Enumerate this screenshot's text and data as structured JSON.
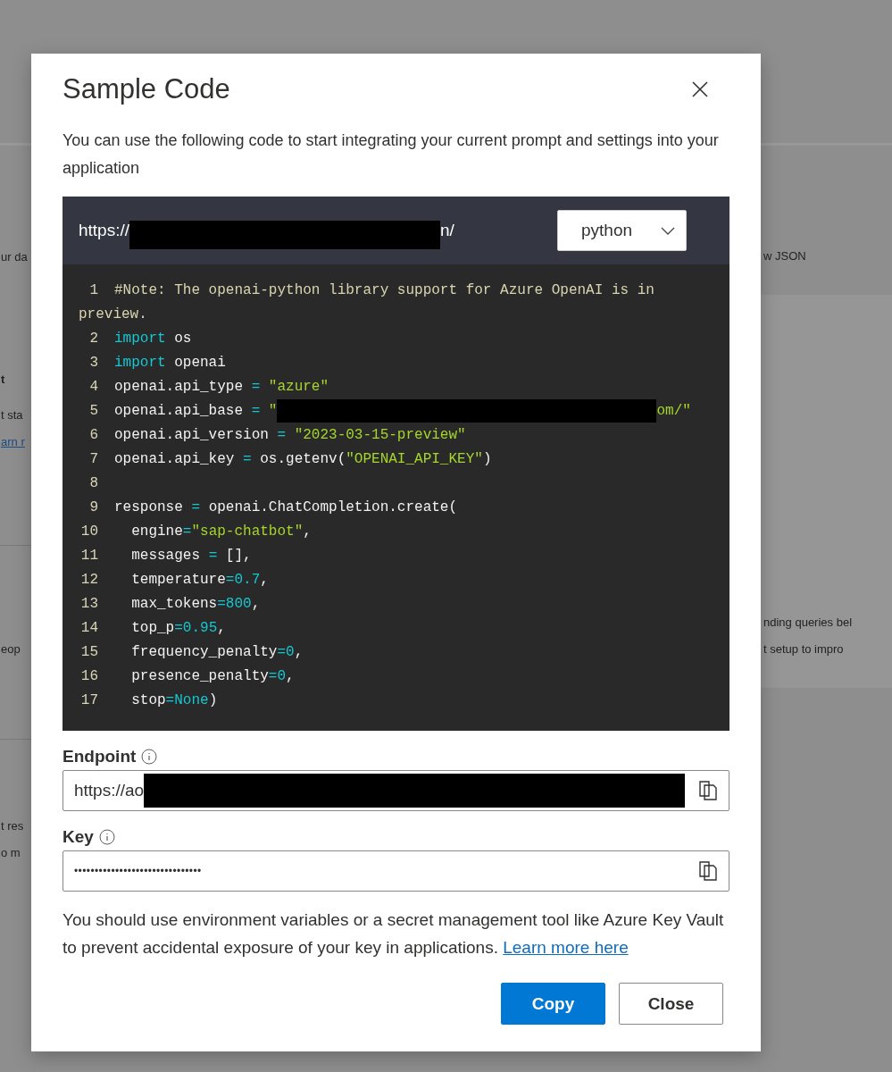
{
  "background": {
    "left": [
      {
        "text": "ur da",
        "kind": "plain"
      },
      {
        "text": "t",
        "kind": "bold"
      },
      {
        "text": "t sta",
        "kind": "plain"
      },
      {
        "text": "arn r",
        "kind": "link"
      },
      {
        "text": "eop",
        "kind": "plain"
      },
      {
        "text": "t res",
        "kind": "plain"
      },
      {
        "text": "o m",
        "kind": "plain"
      }
    ],
    "right": [
      {
        "text": "w JSON"
      },
      {
        "text": "nding queries bel"
      },
      {
        "text": "t setup to impro"
      }
    ]
  },
  "dialog": {
    "title": "Sample Code",
    "description": "You can use the following code to start integrating your current prompt and settings into your application",
    "code": {
      "url_start": "https://",
      "url_end": "n/",
      "language": "python",
      "lines": [
        {
          "number": "1",
          "tokens": [
            {
              "kind": "comment",
              "text": "#Note: The openai-python library support for Azure OpenAI is in preview."
            }
          ]
        },
        {
          "number": "2",
          "tokens": [
            {
              "kind": "keyword",
              "text": "import"
            },
            {
              "kind": "plain",
              "text": " os"
            }
          ]
        },
        {
          "number": "3",
          "tokens": [
            {
              "kind": "keyword",
              "text": "import"
            },
            {
              "kind": "plain",
              "text": " openai"
            }
          ]
        },
        {
          "number": "4",
          "tokens": [
            {
              "kind": "plain",
              "text": "openai.api_type "
            },
            {
              "kind": "op",
              "text": "= "
            },
            {
              "kind": "string",
              "text": "\"azure\""
            }
          ]
        },
        {
          "number": "5",
          "tokens": [
            {
              "kind": "plain",
              "text": "openai.api_base "
            },
            {
              "kind": "op",
              "text": "= "
            },
            {
              "kind": "string",
              "text": "\""
            },
            {
              "kind": "redaction"
            },
            {
              "kind": "string",
              "text": "om/\""
            }
          ]
        },
        {
          "number": "6",
          "tokens": [
            {
              "kind": "plain",
              "text": "openai.api_version "
            },
            {
              "kind": "op",
              "text": "= "
            },
            {
              "kind": "string",
              "text": "\"2023-03-15-preview\""
            }
          ]
        },
        {
          "number": "7",
          "tokens": [
            {
              "kind": "plain",
              "text": "openai.api_key "
            },
            {
              "kind": "op",
              "text": "= "
            },
            {
              "kind": "plain",
              "text": "os.getenv("
            },
            {
              "kind": "string",
              "text": "\"OPENAI_API_KEY\""
            },
            {
              "kind": "plain",
              "text": ")"
            }
          ]
        },
        {
          "number": "8"
        },
        {
          "number": "9",
          "tokens": [
            {
              "kind": "plain",
              "text": "response "
            },
            {
              "kind": "op",
              "text": "= "
            },
            {
              "kind": "plain",
              "text": "openai.ChatCompletion.create("
            }
          ]
        },
        {
          "number": "10",
          "tokens": [
            {
              "kind": "plain",
              "text": "  engine"
            },
            {
              "kind": "op",
              "text": "="
            },
            {
              "kind": "string",
              "text": "\"sap-chatbot\""
            },
            {
              "kind": "plain",
              "text": ","
            }
          ]
        },
        {
          "number": "11",
          "tokens": [
            {
              "kind": "plain",
              "text": "  messages "
            },
            {
              "kind": "op",
              "text": "= "
            },
            {
              "kind": "plain",
              "text": "[],"
            }
          ]
        },
        {
          "number": "12",
          "tokens": [
            {
              "kind": "plain",
              "text": "  temperature"
            },
            {
              "kind": "op",
              "text": "=0.7"
            },
            {
              "kind": "plain",
              "text": ","
            }
          ]
        },
        {
          "number": "13",
          "tokens": [
            {
              "kind": "plain",
              "text": "  max_tokens"
            },
            {
              "kind": "op",
              "text": "=800"
            },
            {
              "kind": "plain",
              "text": ","
            }
          ]
        },
        {
          "number": "14",
          "tokens": [
            {
              "kind": "plain",
              "text": "  top_p"
            },
            {
              "kind": "op",
              "text": "=0.95"
            },
            {
              "kind": "plain",
              "text": ","
            }
          ]
        },
        {
          "number": "15",
          "tokens": [
            {
              "kind": "plain",
              "text": "  frequency_penalty"
            },
            {
              "kind": "op",
              "text": "=0"
            },
            {
              "kind": "plain",
              "text": ","
            }
          ]
        },
        {
          "number": "16",
          "tokens": [
            {
              "kind": "plain",
              "text": "  presence_penalty"
            },
            {
              "kind": "op",
              "text": "=0"
            },
            {
              "kind": "plain",
              "text": ","
            }
          ]
        },
        {
          "number": "17",
          "tokens": [
            {
              "kind": "plain",
              "text": "  stop"
            },
            {
              "kind": "op",
              "text": "=None"
            },
            {
              "kind": "plain",
              "text": ")"
            }
          ]
        }
      ]
    },
    "endpoint": {
      "label": "Endpoint",
      "value": "https://ao"
    },
    "key": {
      "label": "Key",
      "value": "•••••••••••••••••••••••••••••••"
    },
    "note": "You should use environment variables or a secret management tool like Azure Key Vault to prevent accidental exposure of your key in applications.",
    "note_link": "Learn more here",
    "buttons": [
      {
        "label": "Copy",
        "kind": "primary"
      },
      {
        "label": "Close",
        "kind": "secondary"
      }
    ]
  }
}
